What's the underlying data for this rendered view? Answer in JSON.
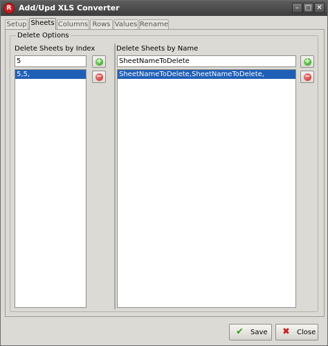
{
  "window": {
    "title": "Add/Upd XLS Converter",
    "app_icon_glyph": "R",
    "controls": {
      "minimize": "–",
      "maximize": "□",
      "close": "✕"
    }
  },
  "tabs": [
    {
      "label": "Setup",
      "active": false
    },
    {
      "label": "Sheets",
      "active": true
    },
    {
      "label": "Columns",
      "active": false
    },
    {
      "label": "Rows",
      "active": false
    },
    {
      "label": "Values",
      "active": false
    },
    {
      "label": "Rename",
      "active": false
    }
  ],
  "delete_options": {
    "legend": "Delete Options",
    "by_index": {
      "label": "Delete Sheets by Index",
      "input_value": "5",
      "list_items": [
        "5,5,"
      ],
      "add_icon": "plus-circle-icon",
      "remove_icon": "minus-circle-icon"
    },
    "by_name": {
      "label": "Delete Sheets by Name",
      "input_value": "SheetNameToDelete",
      "list_items": [
        "SheetNameToDelete,SheetNameToDelete,"
      ],
      "add_icon": "plus-circle-icon",
      "remove_icon": "minus-circle-icon"
    }
  },
  "footer": {
    "save_label": "Save",
    "close_label": "Close",
    "save_icon": "checkmark-icon",
    "close_icon": "x-icon"
  },
  "colors": {
    "selection": "#1f5fb7",
    "titlebar": "#4a4a4a",
    "add": "#2f9a1e",
    "remove": "#c62020"
  }
}
